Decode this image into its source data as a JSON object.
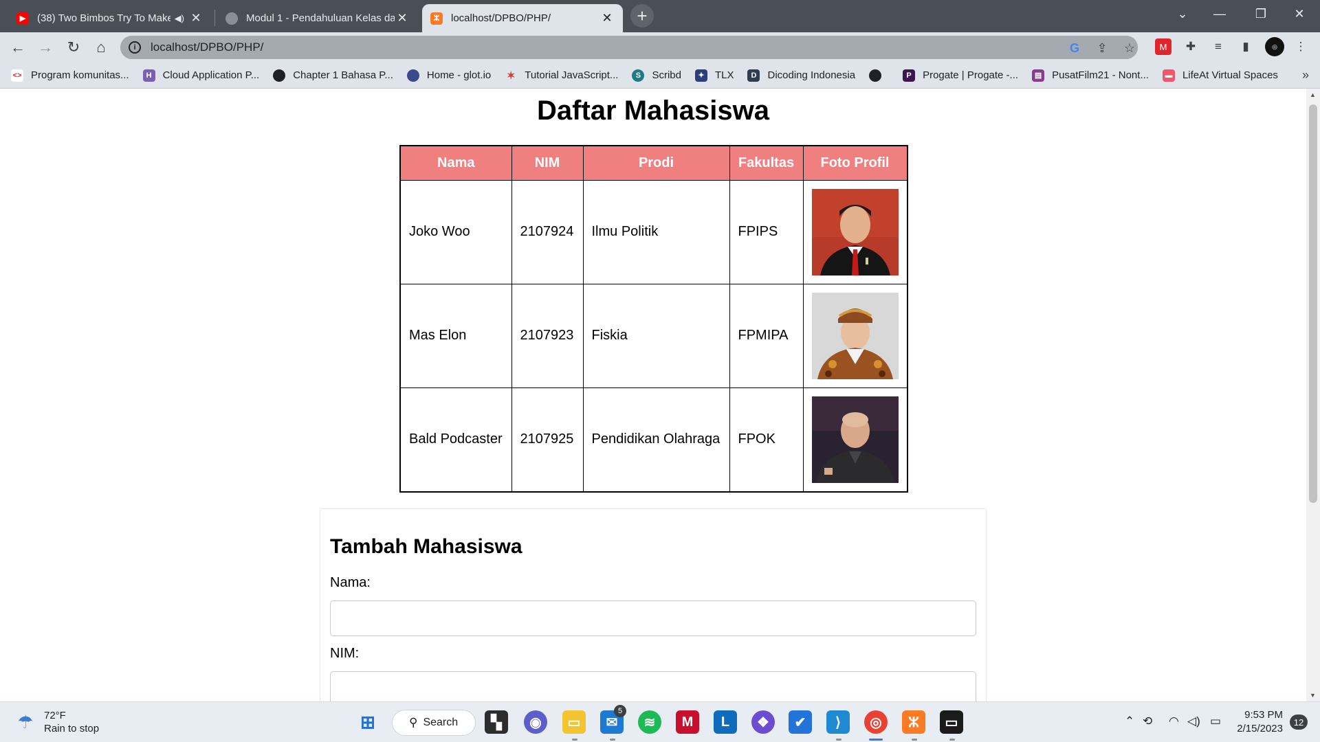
{
  "browser": {
    "tabs": [
      {
        "title": "(38) Two Bimbos Try To Make",
        "favicon": "youtube-icon",
        "color": "#ff0000",
        "audio": "speaker-icon"
      },
      {
        "title": "Modul 1 - Pendahuluan Kelas dan",
        "favicon": "globe-icon"
      },
      {
        "title": "localhost/DPBO/PHP/",
        "favicon": "xampp-icon",
        "color": "#fb7a24",
        "active": true
      }
    ],
    "url": "localhost/DPBO/PHP/",
    "new_tab": "+",
    "bookmarks": [
      {
        "label": "Program komunitas...",
        "icon": "code-icon"
      },
      {
        "label": "Cloud Application P...",
        "icon": "heroku-icon"
      },
      {
        "label": "Chapter 1 Bahasa P...",
        "icon": "globe-icon"
      },
      {
        "label": "Home - glot.io",
        "icon": "glot-icon"
      },
      {
        "label": "Tutorial JavaScript...",
        "icon": "runner-icon"
      },
      {
        "label": "Scribd",
        "icon": "scribd-icon"
      },
      {
        "label": "TLX",
        "icon": "tlx-icon"
      },
      {
        "label": "Dicoding Indonesia",
        "icon": "dicoding-icon"
      },
      {
        "label": "",
        "icon": "globe-icon"
      },
      {
        "label": "Progate | Progate -...",
        "icon": "progate-icon"
      },
      {
        "label": "PusatFilm21 - Nont...",
        "icon": "film-icon"
      },
      {
        "label": "LifeAt Virtual Spaces",
        "icon": "lifeat-icon"
      }
    ]
  },
  "page": {
    "title": "Daftar Mahasiswa",
    "table": {
      "headers": [
        "Nama",
        "NIM",
        "Prodi",
        "Fakultas",
        "Foto Profil"
      ],
      "rows": [
        {
          "nama": "Joko Woo",
          "nim": "2107924",
          "prodi": "Ilmu Politik",
          "fakultas": "FPIPS"
        },
        {
          "nama": "Mas Elon",
          "nim": "2107923",
          "prodi": "Fiskia",
          "fakultas": "FPMIPA"
        },
        {
          "nama": "Bald Podcaster",
          "nim": "2107925",
          "prodi": "Pendidikan Olahraga",
          "fakultas": "FPOK"
        }
      ]
    },
    "form": {
      "heading": "Tambah Mahasiswa",
      "nama_label": "Nama:",
      "nama_value": "",
      "nim_label": "NIM:",
      "nim_value": ""
    }
  },
  "taskbar": {
    "weather_temp": "72°F",
    "weather_desc": "Rain to stop",
    "search_label": "Search",
    "mail_badge": "5",
    "time": "9:53 PM",
    "date": "2/15/2023",
    "notifications": "12"
  },
  "colors": {
    "table_header": "#f08080",
    "accent": "#3b7bd3"
  }
}
